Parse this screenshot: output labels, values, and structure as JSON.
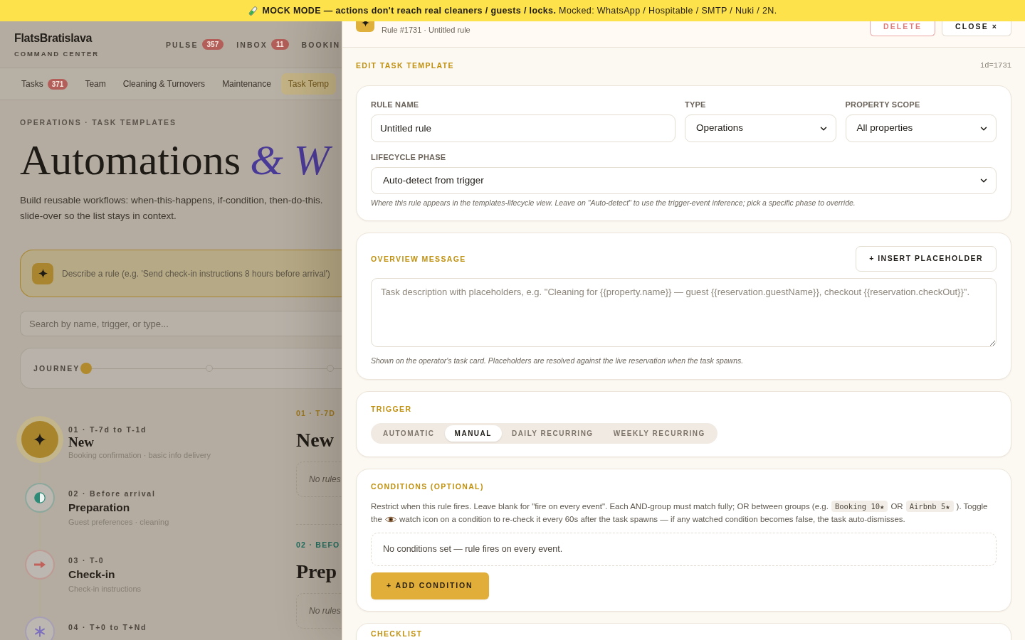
{
  "banner": {
    "text": "**MOCK MODE — actions don't reach real cleaners / guests / locks.** Mocked: WhatsApp / Hospitable / SMTP / Nuki / 2N."
  },
  "header": {
    "brand": "FlatsBratislava",
    "tagline": "COMMAND CENTER",
    "nav": [
      {
        "label": "PULSE",
        "badge": "357"
      },
      {
        "label": "INBOX",
        "badge": "11"
      },
      {
        "label": "BOOKIN"
      }
    ]
  },
  "tabs": [
    {
      "label": "Tasks",
      "badge": "371",
      "selected": false
    },
    {
      "label": "Team",
      "selected": false
    },
    {
      "label": "Cleaning & Turnovers",
      "selected": false
    },
    {
      "label": "Maintenance",
      "selected": false
    },
    {
      "label": "Task Temp",
      "selected": true
    }
  ],
  "page": {
    "eyebrow": "OPERATIONS · TASK TEMPLATES",
    "title": "Automations",
    "title_accent": "& W",
    "description": [
      "Build reusable workflows: when-this-happens, if-condition, then-do-this.",
      "slide-over so the list stays in context."
    ],
    "describe_placeholder": "Describe a rule (e.g. 'Send check-in instructions 8 hours before arrival')",
    "search_placeholder": "Search by name, trigger, or type..."
  },
  "journey": {
    "label": "JOURNEY",
    "stops": [
      {
        "selected": true
      },
      {
        "selected": false
      },
      {
        "selected": false
      }
    ]
  },
  "steps": [
    {
      "eyebrow": "01 · T-7d to T-1d",
      "title": "New",
      "subtitle": "Booking confirmation · basic info delivery",
      "selected": true,
      "color": "#a8852c"
    },
    {
      "eyebrow": "02 · Before arrival",
      "title": "Preparation",
      "subtitle": "Guest preferences · cleaning",
      "selected": false,
      "color": "#2c8a77"
    },
    {
      "eyebrow": "03 · T-0",
      "title": "Check-in",
      "subtitle": "Check-in instructions",
      "selected": false,
      "color": "#c1615a"
    },
    {
      "eyebrow": "04 · T+0 to T+Nd",
      "selected": false,
      "color": "#7d6fc0"
    }
  ],
  "phases": [
    {
      "eyebrow": "01 · T-7D",
      "title": "New",
      "empty": "No rules",
      "color": "#9b7519"
    },
    {
      "eyebrow": "02 · BEFO",
      "title": "Prep",
      "empty": "No rules",
      "color": "#1e6e60"
    }
  ],
  "panel": {
    "subtitle": "Rule #1731 · Untitled rule",
    "actions": [
      {
        "label": "DELETE",
        "kind": "danger"
      },
      {
        "label": "CLOSE ×",
        "kind": "plain"
      }
    ],
    "section_title": "EDIT TASK TEMPLATE",
    "record_id": "id=1731",
    "basics": {
      "fields": [
        {
          "label": "RULE NAME",
          "kind": "text",
          "value": "Untitled rule"
        },
        {
          "label": "TYPE",
          "kind": "select",
          "value": "Operations"
        },
        {
          "label": "PROPERTY SCOPE",
          "kind": "select",
          "value": "All properties"
        }
      ],
      "lifecycle": {
        "label": "LIFECYCLE PHASE",
        "value": "Auto-detect from trigger",
        "hint": "Where this rule appears in the templates-lifecycle view. Leave on \"Auto-detect\" to use the trigger-event inference; pick a specific phase to override."
      }
    },
    "overview": {
      "title": "OVERVIEW MESSAGE",
      "button": "+ INSERT PLACEHOLDER",
      "placeholder": "Task description with placeholders, e.g. \"Cleaning for {{property.name}} — guest {{reservation.guestName}}, checkout {{reservation.checkOut}}\".",
      "hint": "Shown on the operator's task card. Placeholders are resolved against the live reservation when the task spawns."
    },
    "trigger": {
      "title": "TRIGGER",
      "options": [
        {
          "label": "AUTOMATIC",
          "selected": false
        },
        {
          "label": "MANUAL",
          "selected": true
        },
        {
          "label": "DAILY RECURRING",
          "selected": false
        },
        {
          "label": "WEEKLY RECURRING",
          "selected": false
        }
      ]
    },
    "conditions": {
      "title": "CONDITIONS (OPTIONAL)",
      "help_line1": [
        {
          "kind": "text",
          "text": "Restrict when this rule fires. Leave blank for \"fire on every event\". Each AND-group must match fully; OR between groups (e.g."
        },
        {
          "kind": "code",
          "text": "Booking 10★"
        },
        {
          "kind": "text",
          "text": "OR"
        },
        {
          "kind": "code",
          "text": "Airbnb 5★"
        },
        {
          "kind": "text",
          "text": "). Toggle"
        }
      ],
      "help_line2_before": "the",
      "help_line2_after": "watch icon on a condition to re-check it every 60s after the task spawns — if any watched condition becomes false, the task auto-dismisses.",
      "empty": "No conditions set — rule fires on every event.",
      "button": "+ ADD CONDITION"
    },
    "checklist": {
      "title": "CHECKLIST"
    }
  }
}
